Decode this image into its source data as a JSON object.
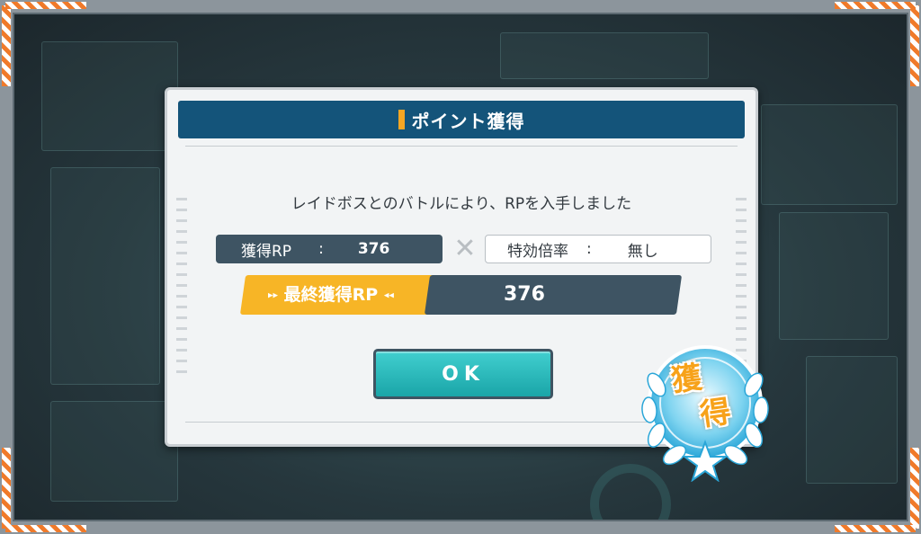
{
  "dialog": {
    "title": "ポイント獲得",
    "message": "レイドボスとのバトルにより、RPを入手しました",
    "rp": {
      "label": "獲得RP",
      "separator": ":",
      "value": "376"
    },
    "multiplier": {
      "label": "特効倍率",
      "separator": ":",
      "value": "無し"
    },
    "final": {
      "label": "最終獲得RP",
      "value": "376"
    },
    "ok_label": "OK"
  },
  "emblem": {
    "char_1": "獲",
    "char_2": "得"
  },
  "icons": {
    "times": "times-icon",
    "laurel": "laurel-icon",
    "star": "star-icon"
  },
  "colors": {
    "header": "#14547a",
    "accent": "#f5a623",
    "panel_dark": "#3e5463",
    "button": "#2bbcbd"
  }
}
